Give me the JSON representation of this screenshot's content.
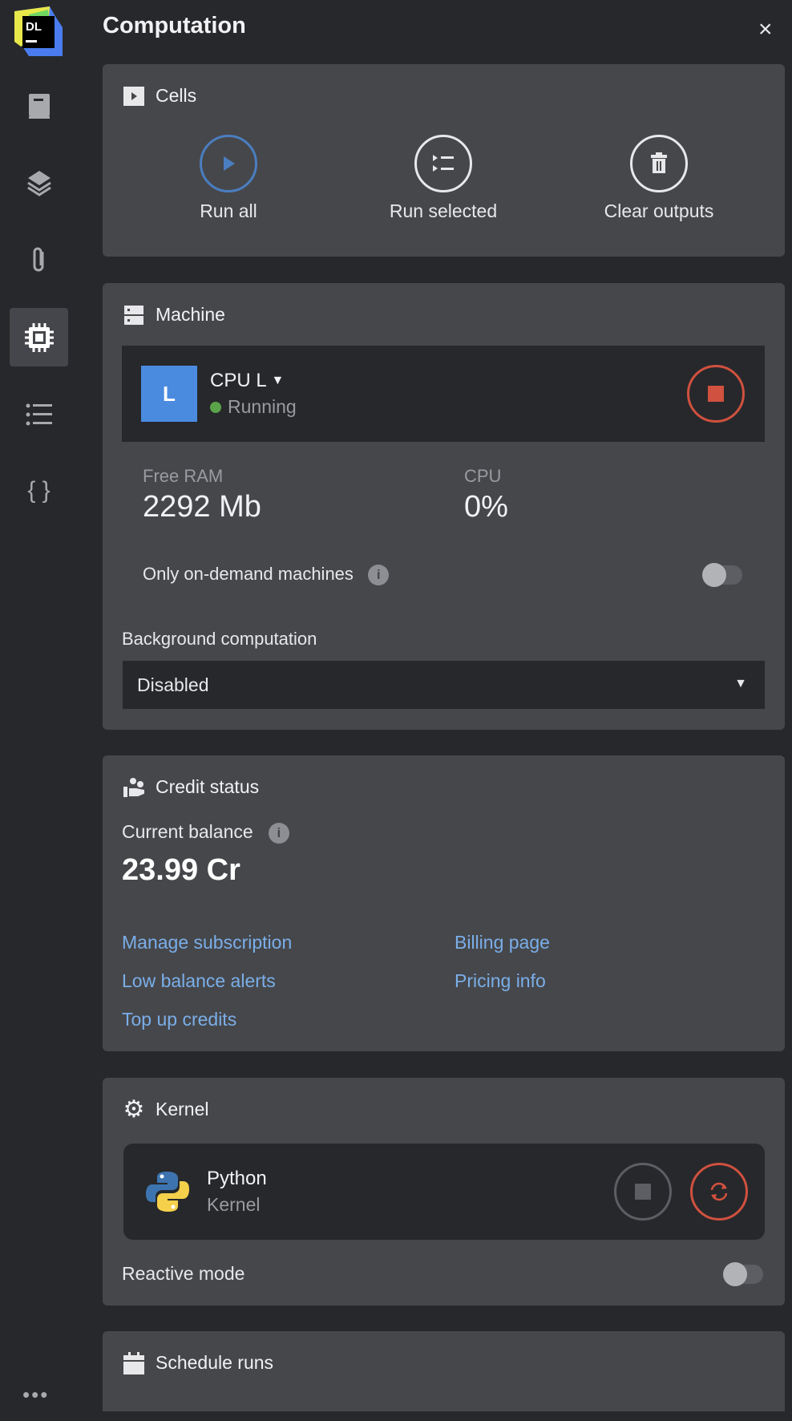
{
  "header": {
    "title": "Computation",
    "close": "×"
  },
  "logo": {
    "text": "DL"
  },
  "sidebar": {
    "more": "•••"
  },
  "cells": {
    "title": "Cells",
    "buttons": [
      {
        "label": "Run all"
      },
      {
        "label": "Run selected"
      },
      {
        "label": "Clear outputs"
      }
    ]
  },
  "machine": {
    "title": "Machine",
    "badge": "L",
    "name": "CPU L",
    "status": "Running",
    "free_ram_label": "Free RAM",
    "free_ram": "2292 Mb",
    "cpu_label": "CPU",
    "cpu": "0%",
    "on_demand_label": "Only on-demand machines",
    "bg_label": "Background computation",
    "bg_value": "Disabled",
    "colors": {
      "badge": "#4a8be0",
      "running": "#5aa34a",
      "stop": "#d0513f"
    }
  },
  "credit": {
    "title": "Credit status",
    "balance_label": "Current balance",
    "balance": "23.99 Cr",
    "links": [
      "Manage subscription",
      "Billing page",
      "Low balance alerts",
      "Pricing info",
      "Top up credits"
    ]
  },
  "kernel": {
    "title": "Kernel",
    "name": "Python",
    "sub": "Kernel",
    "reactive_label": "Reactive mode"
  },
  "schedule": {
    "title": "Schedule runs"
  }
}
